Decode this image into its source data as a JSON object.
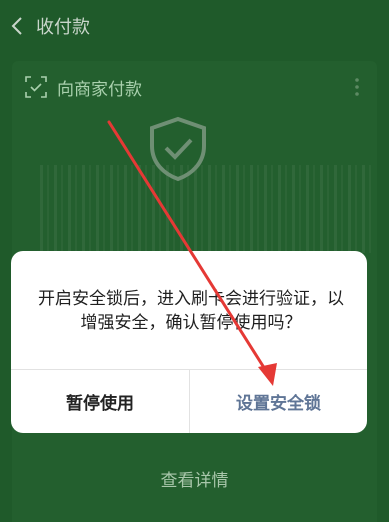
{
  "header": {
    "title": "收付款",
    "back_icon": "chevron-left-icon"
  },
  "card": {
    "title": "向商家付款",
    "scan_icon": "scan-icon",
    "more_icon": "more-vertical-icon"
  },
  "dialog": {
    "message": "开启安全锁后，进入刷卡会进行验证，以增强安全，确认暂停使用吗？",
    "pause_label": "暂停使用",
    "set_lock_label": "设置安全锁"
  },
  "footer": {
    "details_label": "查看详情"
  },
  "colors": {
    "background": "#1f5a2a",
    "card": "#235f2e",
    "accent_text": "#a9d0ad",
    "primary_button": "#5f7596",
    "annotation_arrow": "#e53935"
  }
}
